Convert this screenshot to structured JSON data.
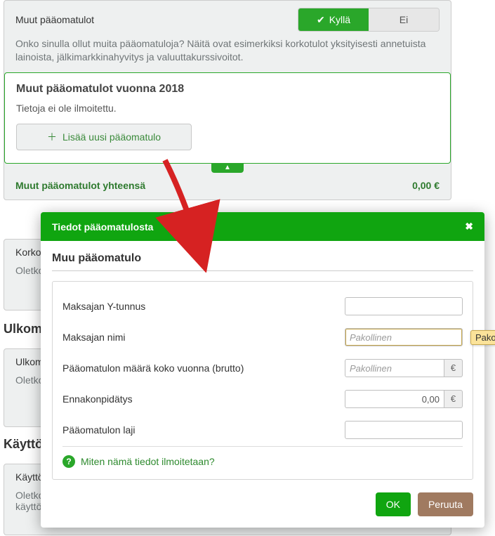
{
  "bg": {
    "section1": {
      "rowLabel": "Muut pääomatulot",
      "yes": "Kyllä",
      "no": "Ei",
      "desc": "Onko sinulla ollut muita pääomatuloja? Näitä ovat esimerkiksi korkotulot yksityisesti annetuista lainoista, jälkimarkkinahyvitys ja valuuttakurssivoitot.",
      "innerTitle": "Muut pääomatulot vuonna 2018",
      "innerText": "Tietoja ei ole ilmoitettu.",
      "addBtn": "Lisää uusi pääomatulo",
      "totalsLabel": "Muut pääomatulot yhteensä",
      "totalsValue": "0,00 €"
    },
    "strip2Title": "Korko",
    "strip2Desc": "Oletko makse",
    "section3Head": "Ulkom",
    "strip3Title": "Ulkom",
    "strip3Desc": "Oletko eläke-",
    "section4Head": "Käyttö",
    "strip4Title": "Käyttö",
    "strip4Desc": "Oletko tekijänoikeuden tai esimerkiksi patentin tai muun teollisoikeuden käyttämisestä, käyttöoikeudesta"
  },
  "modal": {
    "title": "Tiedot pääomatulosta",
    "subtitle": "Muu pääomatulo",
    "rows": {
      "r1": "Maksajan Y-tunnus",
      "r2": "Maksajan nimi",
      "r3": "Pääomatulon määrä koko vuonna (brutto)",
      "r4": "Ennakonpidätys",
      "r5": "Pääomatulon laji"
    },
    "placeholders": {
      "required": "Pakollinen"
    },
    "values": {
      "r4": "0,00"
    },
    "currency": "€",
    "helpText": "Miten nämä tiedot ilmoitetaan?",
    "ok": "OK",
    "cancel": "Peruuta"
  },
  "tooltip": "Pakol"
}
